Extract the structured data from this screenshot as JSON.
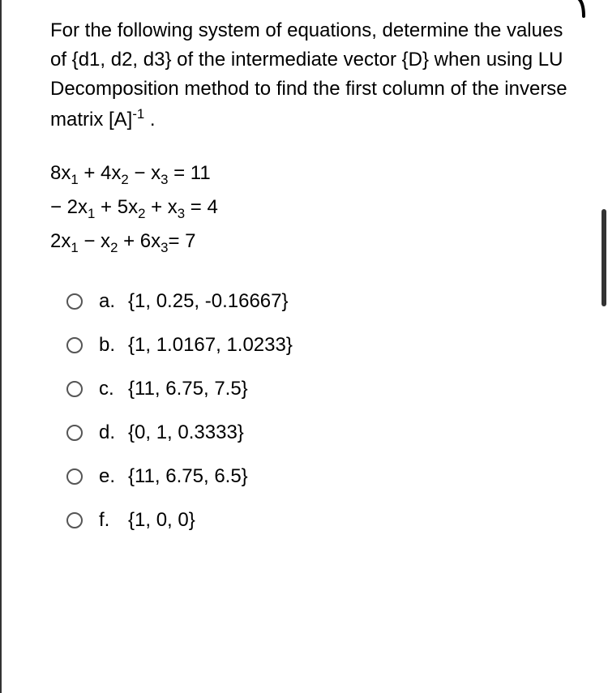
{
  "question": {
    "text_html": "For the following system of equations, determine the values of {d1, d2, d3} of the intermediate vector {D} when using LU Decomposition method to find the first column of the inverse matrix [A]<sup>-1</sup> ."
  },
  "equations": [
    "8x<sub>1</sub> + 4x<sub>2</sub> − x<sub>3</sub> = 11",
    "− 2x<sub>1</sub> + 5x<sub>2</sub> + x<sub>3</sub> = 4",
    "2x<sub>1</sub> − x<sub>2</sub> + 6x<sub>3</sub>= 7"
  ],
  "options": [
    {
      "letter": "a.",
      "text": "{1, 0.25, -0.16667}"
    },
    {
      "letter": "b.",
      "text": "{1, 1.0167, 1.0233}"
    },
    {
      "letter": "c.",
      "text": "{11, 6.75, 7.5}"
    },
    {
      "letter": "d.",
      "text": "{0, 1, 0.3333}"
    },
    {
      "letter": "e.",
      "text": "{11, 6.75, 6.5}"
    },
    {
      "letter": "f.",
      "text": "{1, 0, 0}"
    }
  ]
}
